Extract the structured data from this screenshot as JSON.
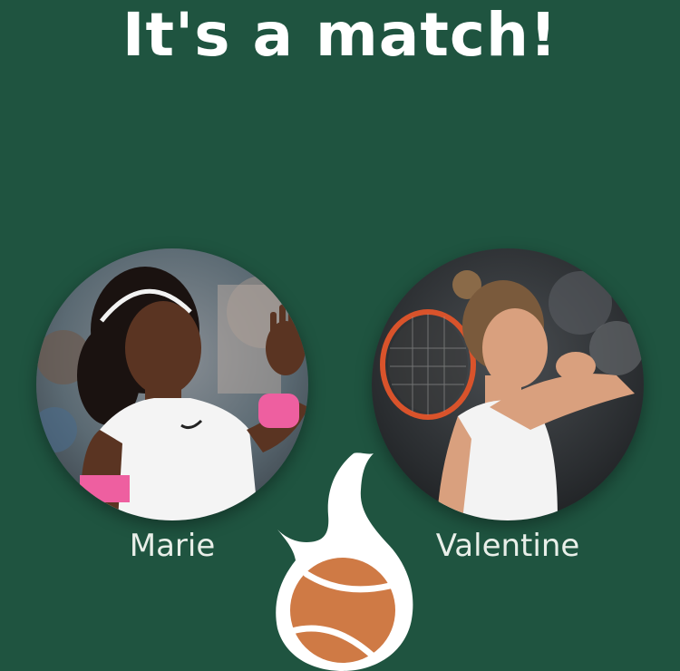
{
  "screen": {
    "title": "It's a match!"
  },
  "profiles": [
    {
      "name": "Marie",
      "photo_icon": "player-photo-marie"
    },
    {
      "name": "Valentine",
      "photo_icon": "player-photo-valentine"
    }
  ],
  "logo": {
    "icon": "tennis-ball-flame-logo"
  },
  "colors": {
    "background": "#1f5440",
    "title": "#ffffff",
    "name": "#e9efe9",
    "ball": "#cf7a45",
    "logo_flame": "#ffffff"
  }
}
